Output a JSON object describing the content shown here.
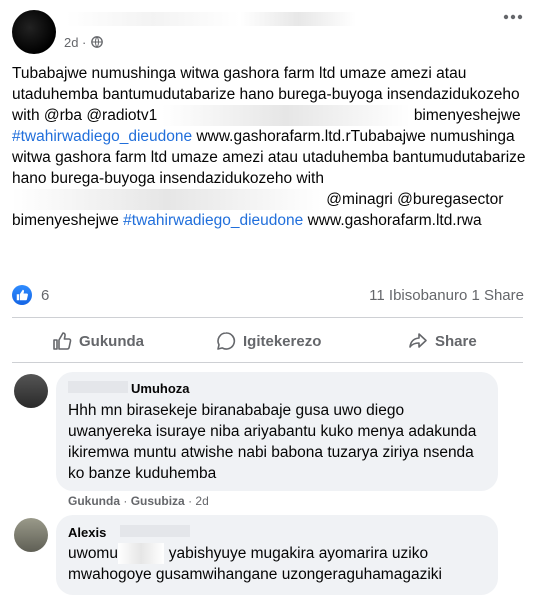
{
  "post": {
    "timestamp": "2d",
    "dot": "·",
    "text_parts": [
      {
        "t": "Tubabajwe numushinga witwa gashora farm ltd umaze amezi atau utaduhemba bantumudutabarize hano burega-buyoga insendazidukozeho with @rba @radiotv1 "
      },
      {
        "t": "bimenyeshejwe "
      },
      {
        "t": "#twahirwadiego_dieudone",
        "hashtag": true
      },
      {
        "t": " www.gashorafarm.ltd.rTubabajwe numushinga witwa gashora farm ltd umaze amezi atau utaduhemba bantumudutabarize hano burega-buyoga insendazidukozeho with "
      },
      {
        "t": " @minagri @buregasector  bimenyeshejwe "
      },
      {
        "t": "#twahirwadiego_dieudone",
        "hashtag": true
      },
      {
        "t": " www.gashorafarm.ltd.rwa"
      }
    ]
  },
  "reactions": {
    "count": "6",
    "stats": "11 Ibisobanuro  1 Share"
  },
  "actions": {
    "like_label": "Gukunda",
    "comment_label": "Igitekerezo",
    "share_label": "Share"
  },
  "comments": [
    {
      "name": "Umuhoza",
      "text": "Hhh mn birasekeje biranababaje gusa uwo diego uwanyereka isuraye niba ariyabantu kuko menya adakunda ikiremwa muntu atwishe nabi babona tuzarya ziriya nsenda ko banze kuduhemba",
      "like": "Gukunda",
      "reply": "Gusubiza",
      "time": "2d"
    },
    {
      "name": "Alexis",
      "text_a": "uwomu",
      "text_b": "yabishyuye mugakira ayomarira uziko mwahogoye gusamwihangane uzongeraguhamagaziki"
    }
  ]
}
